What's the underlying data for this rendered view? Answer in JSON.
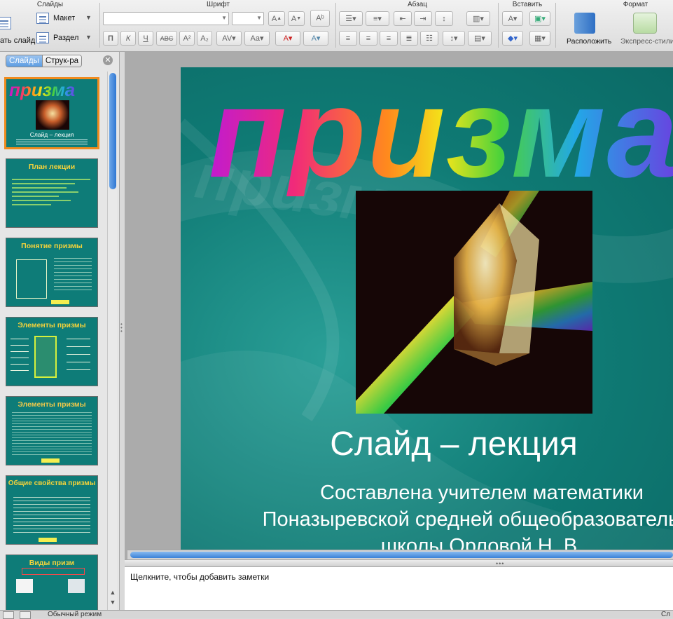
{
  "ribbon": {
    "groups": {
      "slides": "Слайды",
      "font": "Шрифт",
      "paragraph": "Абзац",
      "insert": "Вставить",
      "format": "Формат"
    },
    "new_slide_label": "ать слайд",
    "layout_label": "Макет",
    "section_label": "Раздел",
    "arrange_label": "Расположить",
    "quick_styles_label": "Экспресс-стили"
  },
  "left_pane": {
    "tabs": [
      "Слайды",
      "Струк-ра"
    ],
    "active_tab": 0,
    "thumbnails": [
      {
        "title": "призма",
        "caption": "Слайд – лекция",
        "selected": true
      },
      {
        "title": "План лекции",
        "selected": false
      },
      {
        "title": "Понятие призмы",
        "selected": false
      },
      {
        "title": "Элементы призмы",
        "selected": false
      },
      {
        "title": "Элементы призмы",
        "selected": false
      },
      {
        "title": "Общие свойства призмы",
        "selected": false
      },
      {
        "title": "Виды призм",
        "selected": false
      }
    ]
  },
  "slide": {
    "wordart": "призма",
    "title": "Слайд – лекция",
    "subtitle_lines": [
      "Составлена учителем математики",
      "Поназыревской средней общеобразовательно",
      "школы Орловой Н. В."
    ]
  },
  "notes": {
    "placeholder": "Щелкните, чтобы добавить заметки"
  },
  "status": {
    "view_mode": "Обычный режим",
    "right_text": "Сл"
  },
  "colors": {
    "slide_bg": "#0f7a74",
    "thumb_title": "#f4d23b",
    "selection": "#f08b1e",
    "scroll_accent": "#3b82d8"
  }
}
